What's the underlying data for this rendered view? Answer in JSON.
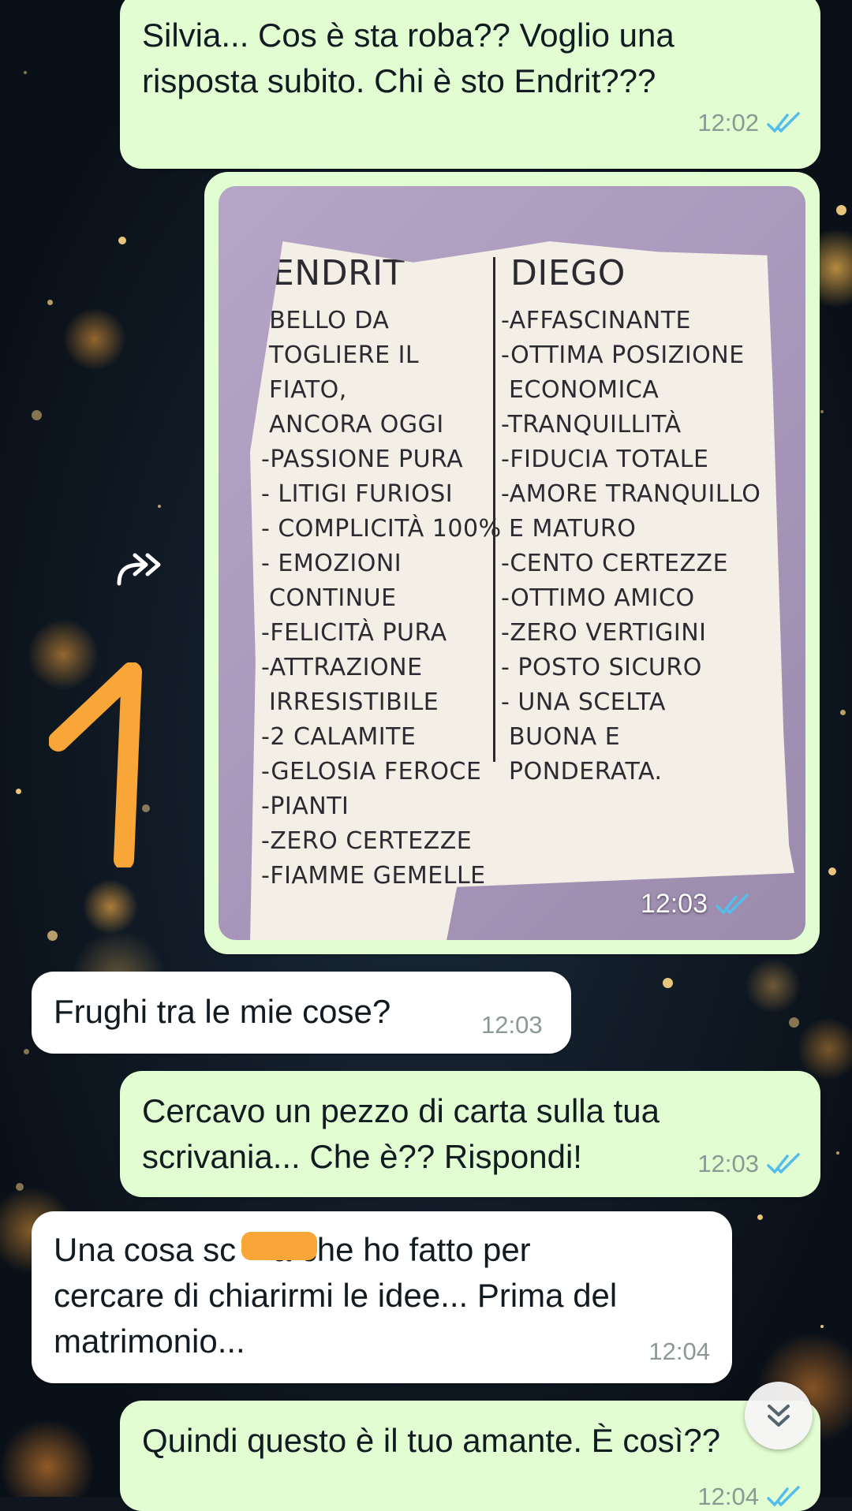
{
  "messages": [
    {
      "id": "m1",
      "direction": "outgoing",
      "lines": [
        "Silvia... Cos è sta roba?? Voglio una",
        "risposta subito. Chi è sto Endrit???"
      ],
      "time": "12:02",
      "status": "read"
    },
    {
      "id": "m2",
      "direction": "outgoing",
      "type": "image",
      "time": "12:03",
      "status": "read",
      "note": {
        "left_title": "ENDRIT",
        "left_items": [
          "-BELLO DA",
          " TOGLIERE IL",
          " FIATO,",
          " ANCORA OGGI",
          "-PASSIONE PURA",
          "- LITIGI FURIOSI",
          "- COMPLICITÀ 100%",
          "- EMOZIONI",
          " CONTINUE",
          "-FELICITÀ PURA",
          "-ATTRAZIONE",
          " IRRESISTIBILE",
          "-2 CALAMITE",
          "-GELOSIA FEROCE",
          "-PIANTI",
          "-ZERO CERTEZZE",
          "-FIAMME GEMELLE"
        ],
        "right_title": "DIEGO",
        "right_items": [
          "-AFFASCINANTE",
          "-OTTIMA POSIZIONE",
          " ECONOMICA",
          "-TRANQUILLITÀ",
          "-FIDUCIA TOTALE",
          "-AMORE TRANQUILLO",
          " E MATURO",
          "-CENTO CERTEZZE",
          "-OTTIMO AMICO",
          "-ZERO VERTIGINI",
          "- POSTO SICURO",
          "- UNA SCELTA",
          " BUONA E",
          " PONDERATA."
        ]
      }
    },
    {
      "id": "m3",
      "direction": "incoming",
      "lines": [
        "Frughi tra le mie cose?"
      ],
      "time": "12:03"
    },
    {
      "id": "m4",
      "direction": "outgoing",
      "lines": [
        "Cercavo un pezzo di carta sulla tua",
        "scrivania... Che è?? Rispondi!"
      ],
      "time": "12:03",
      "status": "read"
    },
    {
      "id": "m5",
      "direction": "incoming",
      "lines": [
        "Una cosa sc    a che ho fatto per",
        "cercare di chiarirmi le idee... Prima del",
        "matrimonio..."
      ],
      "time": "12:04"
    },
    {
      "id": "m6",
      "direction": "outgoing",
      "lines": [
        "Quindi questo è il tuo amante. È così??"
      ],
      "time": "12:04",
      "status": "read"
    }
  ],
  "colors": {
    "outgoing_bubble": "#e2fdd1",
    "incoming_bubble": "#ffffff",
    "read_tick": "#53bdeb",
    "highlight_orange": "#f7a637"
  },
  "icons": [
    "forward-icon",
    "double-check-icon",
    "scroll-down-icon"
  ]
}
